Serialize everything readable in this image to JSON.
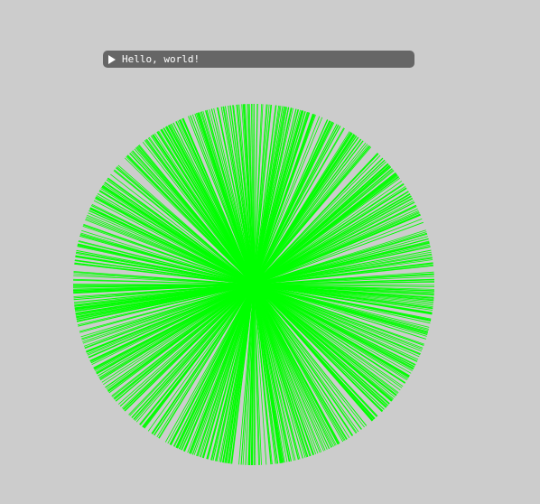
{
  "window": {
    "title": "Hello, world!",
    "collapsed": true
  },
  "burst": {
    "line_color": "#00ff00",
    "background_color": "#cccccc",
    "line_count": 900
  }
}
